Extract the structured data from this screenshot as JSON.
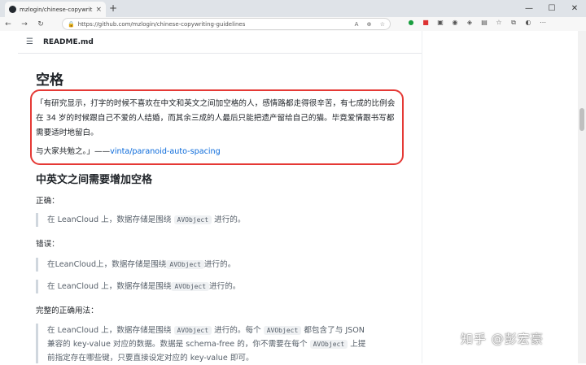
{
  "browser": {
    "tab_title": "mzlogin/chinese-copywriting-gu",
    "tab_close": "×",
    "new_tab": "+",
    "url": "https://github.com/mzlogin/chinese-copywriting-guidelines",
    "window_min": "—",
    "window_max": "☐",
    "window_close": "✕",
    "nav_back": "←",
    "nav_forward": "→",
    "nav_reload": "↻"
  },
  "readme": {
    "filename": "README.md",
    "section_title": "空格",
    "quote_text": "「有研究显示，打字的时候不喜欢在中文和英文之间加空格的人，感情路都走得很辛苦，有七成的比例会在 34 岁的时候跟自己不爱的人结婚，而其余三成的人最后只能把遗产留给自己的猫。毕竟爱情跟书写都需要适时地留白。",
    "quote_sig_prefix": "与大家共勉之。」——",
    "quote_link": "vinta/paranoid-auto-spacing",
    "subsection_title": "中英文之间需要增加空格",
    "correct_label": "正确：",
    "correct_example": {
      "pre": "在 LeanCloud 上，数据存储是围绕 ",
      "code": "AVObject",
      "post": " 进行的。"
    },
    "wrong_label": "错误：",
    "wrong_example_1": {
      "pre": "在LeanCloud上，数据存储是围绕",
      "code": "AVObject",
      "post": "进行的。"
    },
    "wrong_example_2": {
      "pre": "在 LeanCloud 上，数据存储是围绕",
      "code": "AVObject",
      "post": "进行的。"
    },
    "full_label": "完整的正确用法：",
    "full_line1": {
      "pre": "在 LeanCloud 上，数据存储是围绕 ",
      "code1": "AVObject",
      "mid": " 进行的。每个 ",
      "code2": "AVObject",
      "post": " 都包含了与 JSON"
    },
    "full_line2": {
      "pre": "兼容的 key-value 对应的数据。数据是 schema-free 的，你不需要在每个 ",
      "code": "AVObject",
      "post": " 上提"
    },
    "full_line3": "前指定存在哪些键，只要直接设定对应的 key-value 即可。"
  },
  "watermark": "知乎 @彭宏豪",
  "colors": {
    "highlight_border": "#e53935",
    "link": "#0969da"
  }
}
